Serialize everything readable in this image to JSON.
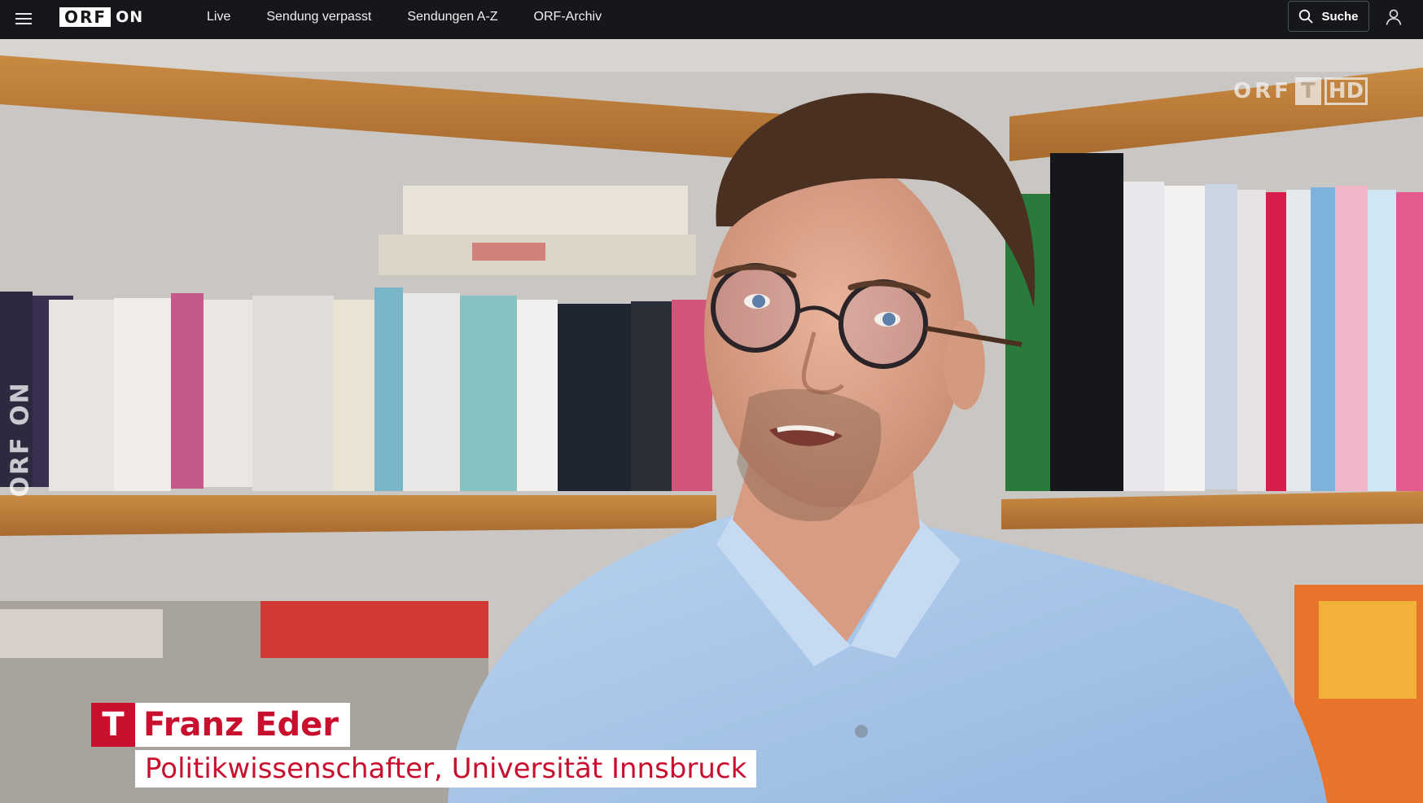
{
  "nav": {
    "menu_icon": "hamburger-icon",
    "logo_box": "ORF",
    "logo_suffix": "ON",
    "links": [
      "Live",
      "Sendung verpasst",
      "Sendungen A-Z",
      "ORF-Archiv"
    ],
    "search_label": "Suche",
    "search_icon": "search-icon",
    "user_icon": "user-icon",
    "background": "#15171a"
  },
  "video": {
    "channel_logo": {
      "orf": "ORF",
      "t": "T",
      "hd": "HD"
    },
    "side_watermark": "ORF ON",
    "lower_third": {
      "badge": "T",
      "name": "Franz Eder",
      "title": "Politikwissenschafter, Universität Innsbruck",
      "accent_color": "#c8102e"
    }
  }
}
